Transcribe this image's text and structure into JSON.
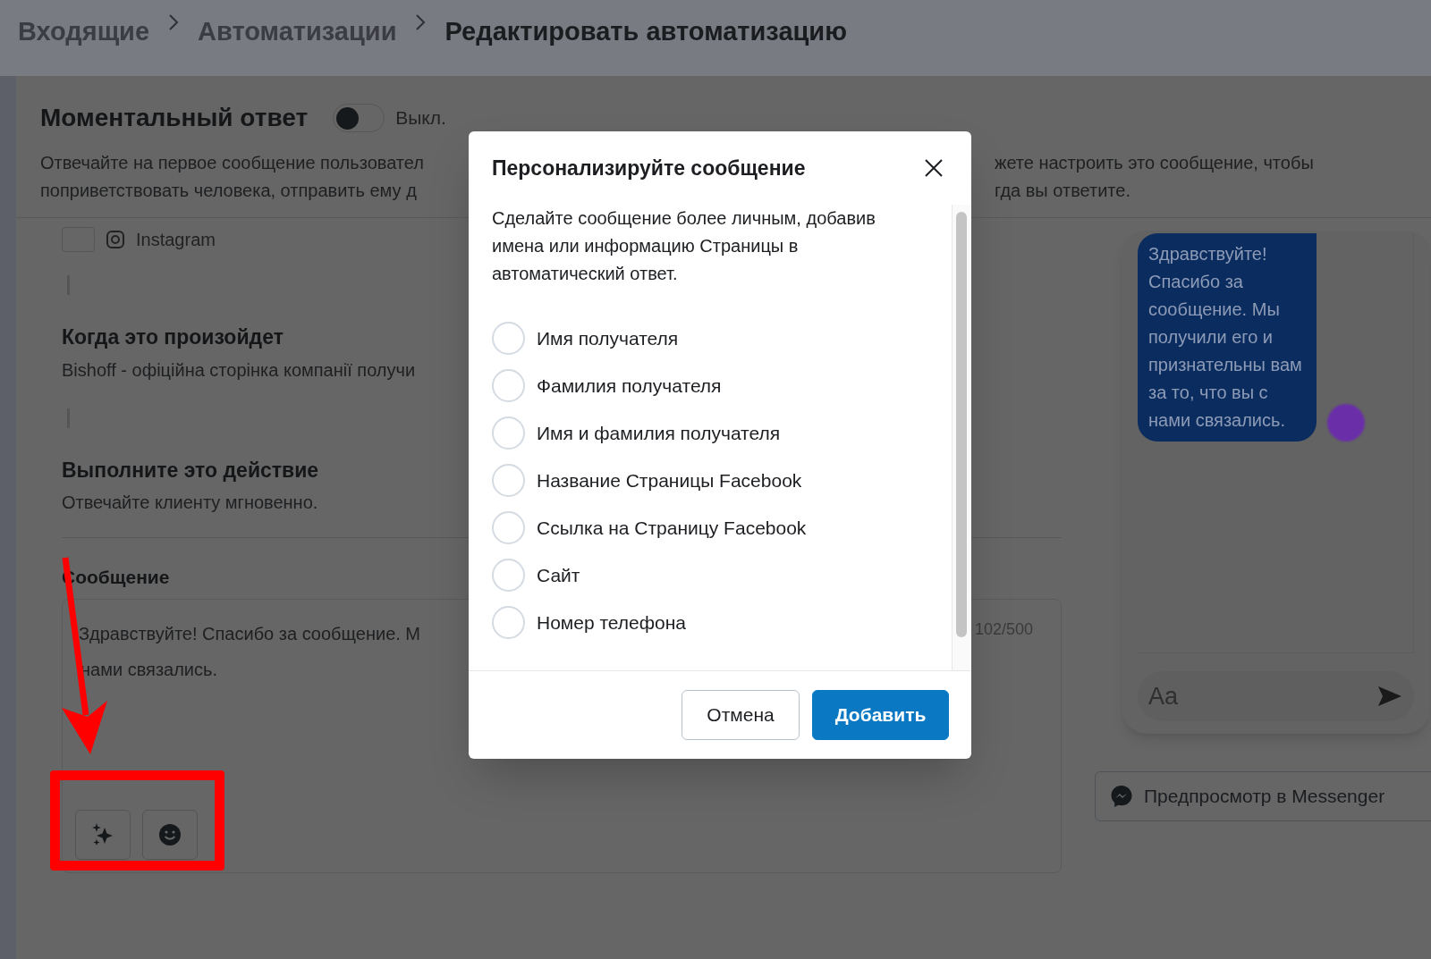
{
  "breadcrumb": [
    {
      "label": "Входящие",
      "current": false
    },
    {
      "label": "Автоматизации",
      "current": false
    },
    {
      "label": "Редактировать автоматизацию",
      "current": true
    }
  ],
  "instant_reply": {
    "title": "Моментальный ответ",
    "toggle": {
      "on": false,
      "label": "Выкл."
    },
    "description_left": [
      "Отвечайте на первое сообщение пользовател",
      "поприветствовать человека, отправить ему д"
    ],
    "description_right": [
      "жете настроить это сообщение, чтобы",
      "гда вы ответите."
    ]
  },
  "channel": {
    "label": "Instagram",
    "checked": false
  },
  "trigger": {
    "title": "Когда это произойдет",
    "text": "Bishoff - офіційна сторінка компанії получи"
  },
  "action": {
    "title": "Выполните это действие",
    "text": "Отвечайте клиенту мгновенно."
  },
  "message": {
    "label": "Сообщение",
    "lines": [
      "Здравствуйте! Спасибо за сообщение. М",
      "нами связались."
    ],
    "counter": "102/500"
  },
  "preview": {
    "bubble": "Здравствуйте! Спасибо за сообщение. Мы получили его и признательны вам за то, что вы с нами связались.",
    "input_placeholder": "Aa",
    "button": "Предпросмотр в Messenger"
  },
  "dialog": {
    "title": "Персонализируйте сообщение",
    "description": "Сделайте сообщение более личным, добавив имена или информацию Страницы в автоматический ответ.",
    "options": [
      {
        "label": "Имя получателя",
        "selected": false
      },
      {
        "label": "Фамилия получателя",
        "selected": false
      },
      {
        "label": "Имя и фамилия получателя",
        "selected": false
      },
      {
        "label": "Название Страницы Facebook",
        "selected": false
      },
      {
        "label": "Ссылка на Страницу Facebook",
        "selected": false
      },
      {
        "label": "Сайт",
        "selected": false
      },
      {
        "label": "Номер телефона",
        "selected": false
      }
    ],
    "buttons": [
      {
        "label": "Отмена",
        "kind": "secondary"
      },
      {
        "label": "Добавить",
        "kind": "primary"
      }
    ]
  }
}
